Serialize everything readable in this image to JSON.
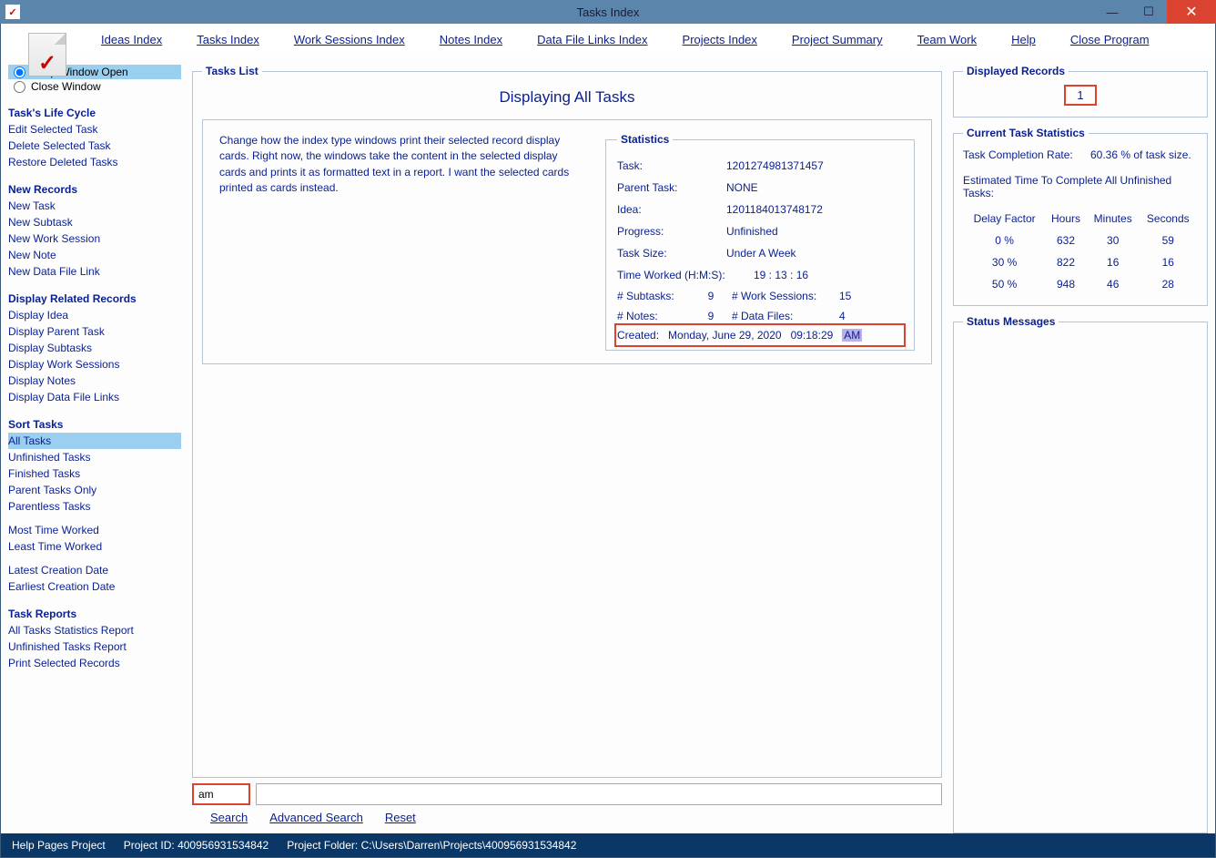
{
  "window": {
    "title": "Tasks Index"
  },
  "menus": {
    "ideas": "Ideas Index",
    "tasks": "Tasks Index",
    "work": "Work Sessions Index",
    "notes": "Notes Index",
    "data": "Data File Links Index",
    "projects": "Projects Index",
    "summary": "Project Summary",
    "team": "Team Work",
    "help": "Help",
    "close": "Close Program"
  },
  "sidebar": {
    "keep_open": "Keep Window Open",
    "close_window": "Close Window",
    "life_cycle_h": "Task's Life Cycle",
    "edit": "Edit Selected Task",
    "delete": "Delete Selected Task",
    "restore": "Restore Deleted Tasks",
    "new_h": "New Records",
    "new_task": "New Task",
    "new_subtask": "New Subtask",
    "new_ws": "New Work Session",
    "new_note": "New Note",
    "new_dfl": "New Data File Link",
    "related_h": "Display Related Records",
    "d_idea": "Display Idea",
    "d_parent": "Display Parent Task",
    "d_sub": "Display Subtasks",
    "d_ws": "Display Work Sessions",
    "d_notes": "Display Notes",
    "d_dfl": "Display Data File Links",
    "sort_h": "Sort Tasks",
    "all": "All Tasks",
    "unfinished": "Unfinished Tasks",
    "finished": "Finished Tasks",
    "parent_only": "Parent Tasks Only",
    "parentless": "Parentless Tasks",
    "most_time": "Most Time Worked",
    "least_time": "Least Time Worked",
    "latest": "Latest Creation Date",
    "earliest": "Earliest Creation Date",
    "reports_h": "Task Reports",
    "r_all": "All Tasks Statistics Report",
    "r_unf": "Unfinished Tasks Report",
    "r_print": "Print Selected Records"
  },
  "tasks_list": {
    "legend": "Tasks List",
    "title": "Displaying All Tasks",
    "card_text": "Change how the index type windows print their selected record display cards. Right now, the windows take the content in the selected display cards and prints it as formatted text in a report. I want the selected cards printed as cards instead."
  },
  "stats": {
    "legend": "Statistics",
    "task_l": "Task:",
    "task_v": "1201274981371457",
    "parent_l": "Parent Task:",
    "parent_v": "NONE",
    "idea_l": "Idea:",
    "idea_v": "1201184013748172",
    "prog_l": "Progress:",
    "prog_v": "Unfinished",
    "size_l": "Task Size:",
    "size_v": "Under A Week",
    "worked_l": "Time Worked (H:M:S):",
    "worked_v": "19  :  13  :  16",
    "sub_l": "# Subtasks:",
    "sub_v": "9",
    "ws_l": "# Work Sessions:",
    "ws_v": "15",
    "notes_l": "# Notes:",
    "notes_v": "9",
    "df_l": "# Data Files:",
    "df_v": "4",
    "created_l": "Created:",
    "created_date": "Monday, June 29, 2020",
    "created_time": "09:18:29",
    "created_ampm": "AM"
  },
  "displayed": {
    "legend": "Displayed Records",
    "value": "1"
  },
  "cts": {
    "legend": "Current Task Statistics",
    "comp_l": "Task Completion Rate:",
    "comp_v": "60.36 % of task size.",
    "est_l": "Estimated Time To Complete All Unfinished Tasks:",
    "h_delay": "Delay Factor",
    "h_hours": "Hours",
    "h_min": "Minutes",
    "h_sec": "Seconds",
    "rows": [
      {
        "d": "0 %",
        "h": "632",
        "m": "30",
        "s": "59"
      },
      {
        "d": "30 %",
        "h": "822",
        "m": "16",
        "s": "16"
      },
      {
        "d": "50 %",
        "h": "948",
        "m": "46",
        "s": "28"
      }
    ]
  },
  "status_legend": "Status Messages",
  "search": {
    "small_value": "am",
    "big_value": "",
    "search": "Search",
    "adv": "Advanced Search",
    "reset": "Reset"
  },
  "statusbar": {
    "p1": "Help Pages Project",
    "p2": "Project ID: 400956931534842",
    "p3": "Project Folder: C:\\Users\\Darren\\Projects\\400956931534842"
  }
}
